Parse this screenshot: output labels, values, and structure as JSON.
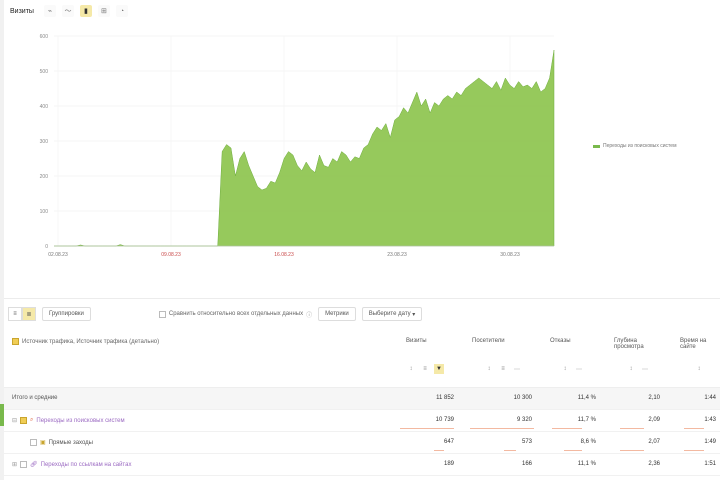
{
  "toolbar": {
    "title": "Визиты",
    "buttons": [
      {
        "name": "line-chart-icon",
        "glyph": "⌁"
      },
      {
        "name": "area-chart-icon",
        "glyph": "〜"
      },
      {
        "name": "bar-chart-icon",
        "glyph": "▮",
        "active": true
      },
      {
        "name": "grid-icon",
        "glyph": "⊞"
      },
      {
        "name": "pie-chart-icon",
        "glyph": "◔"
      }
    ]
  },
  "chart_data": {
    "type": "area",
    "color": "#8bc34a",
    "yticks": [
      "0",
      "100",
      "200",
      "300",
      "400",
      "500",
      "600"
    ],
    "ylim": [
      0,
      600
    ],
    "xticks": [
      {
        "label": "02.08.23",
        "color": "#777"
      },
      {
        "label": "09.08.23",
        "color": "#c94a4a"
      },
      {
        "label": "16.08.23",
        "color": "#c94a4a"
      },
      {
        "label": "23.08.23",
        "color": "#777"
      },
      {
        "label": "30.08.23",
        "color": "#777"
      }
    ],
    "series": [
      {
        "name": "Переходы из поисковых систем",
        "values": [
          0,
          0,
          0,
          0,
          0,
          0,
          3,
          0,
          0,
          0,
          0,
          0,
          0,
          0,
          0,
          4,
          0,
          0,
          0,
          0,
          0,
          0,
          0,
          0,
          0,
          0,
          0,
          0,
          0,
          0,
          0,
          0,
          0,
          0,
          0,
          0,
          0,
          0,
          270,
          290,
          280,
          200,
          250,
          270,
          230,
          200,
          170,
          160,
          165,
          185,
          180,
          210,
          250,
          270,
          260,
          230,
          215,
          240,
          220,
          210,
          260,
          230,
          225,
          250,
          240,
          270,
          260,
          240,
          255,
          250,
          280,
          290,
          320,
          340,
          330,
          350,
          310,
          360,
          370,
          395,
          380,
          410,
          440,
          400,
          420,
          380,
          410,
          400,
          420,
          430,
          420,
          440,
          430,
          450,
          460,
          470,
          480,
          470,
          460,
          450,
          470,
          445,
          480,
          460,
          450,
          470,
          455,
          460,
          450,
          470,
          440,
          450,
          480,
          560
        ]
      }
    ]
  },
  "controls": {
    "segments": [
      "≡",
      "≣"
    ],
    "group_button": "Группировки",
    "checkbox_label": "Сравнить относительно всех отдельных данных",
    "metrics_button": "Метрики",
    "select_label": "Выберите дату"
  },
  "table": {
    "dimension_header": "Источник трафика, Источник трафика (детально)",
    "columns": [
      {
        "label": "Визиты"
      },
      {
        "label": "Посетители"
      },
      {
        "label": "Отказы"
      },
      {
        "label": "Глубина просмотра"
      },
      {
        "label": "Время на сайте"
      }
    ],
    "total": {
      "label": "Итого и средние",
      "values": [
        "11 852",
        "10 300",
        "11,4 %",
        "2,10",
        "1:44"
      ]
    },
    "rows": [
      {
        "label": "Переходы из поисковых систем",
        "link": true,
        "values": [
          "10 739",
          "9 320",
          "11,7 %",
          "2,09",
          "1:43"
        ],
        "bars": [
          0.9,
          0.9,
          0.5,
          0.6,
          0.6
        ]
      },
      {
        "label": "Прямые заходы",
        "link": false,
        "values": "0",
        "values_list": [
          "647",
          "573",
          "8,6 %",
          "2,07",
          "1:49"
        ],
        "bars": [
          0.1,
          0.1,
          0.3,
          0.6,
          0.6
        ]
      },
      {
        "label": "Переходы по ссылкам на сайтах",
        "link": true,
        "values_list": [
          "189",
          "166",
          "11,1 %",
          "2,36",
          "1:51"
        ],
        "bars": [
          0.05,
          0.05,
          0.4,
          0.7,
          0.7
        ]
      }
    ]
  }
}
